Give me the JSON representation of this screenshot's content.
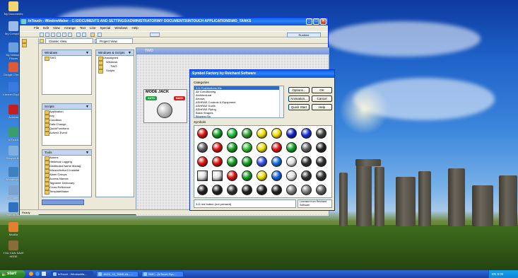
{
  "desktop": {
    "icons": [
      {
        "label": "My Documents",
        "color": "#f2d670"
      },
      {
        "label": "My Computer",
        "color": "#9bbce8"
      },
      {
        "label": "My Network Places",
        "color": "#6aa0e0"
      },
      {
        "label": "Google Chrome",
        "color": "#e05a3a"
      },
      {
        "label": "Internet Explorer",
        "color": "#3a7ae0"
      },
      {
        "label": "Acrobat",
        "color": "#c02020"
      },
      {
        "label": "InTouch",
        "color": "#3c9c6c"
      },
      {
        "label": "Recycle Bin",
        "color": "#7fb0e0"
      },
      {
        "label": "Wonderware",
        "color": "#4080c0"
      },
      {
        "label": "Computer",
        "color": "#7ca0d0"
      },
      {
        "label": "FactoryTalk",
        "color": "#3070c0"
      },
      {
        "label": "Mozilla",
        "color": "#e08030"
      },
      {
        "label": "YOU CAN SAVE HERE",
        "color": "#8a6b3a"
      }
    ]
  },
  "windowmaker": {
    "title": "InTouch - WindowMaker - C:\\DOCUMENTS AND SETTINGS\\ADMINISTRATOR\\MY DOCUMENTS\\INTOUCH APPLICATIONS\\MO_TANKS",
    "menu": [
      "File",
      "Edit",
      "View",
      "Arrange",
      "Text",
      "Line",
      "Special",
      "Windows",
      "Help"
    ],
    "runtime_label": "Runtime",
    "side_items": [
      "File",
      "Edit"
    ],
    "windows_panel": {
      "title": "Windows",
      "items": [
        "TWO"
      ]
    },
    "script_panel": {
      "title": "Scripts",
      "items": [
        "Application",
        "Key",
        "Condition",
        "Data Change",
        "QuickFunctions",
        "ActiveX Event"
      ]
    },
    "tools_panel": {
      "title": "Tools",
      "items": [
        "Alarms",
        "Historical Logging",
        "Distributed Name Manag",
        "Wizard/ActiveX Installat",
        "Alarm Groups",
        "Access Names",
        "Tagname Dictionary",
        "Cross Reference",
        "TemplateMaker"
      ]
    },
    "windows_scripts_panel": {
      "title": "Windows & Scripts",
      "items": [
        "Unassigned",
        "Windows",
        "TWO",
        "Scripts"
      ]
    },
    "project_view_label": "Project View",
    "classic_view_label": "Classic View",
    "canvas_title": "TWO",
    "status_text": "Ready",
    "mode_jack": {
      "title": "MODE JACK",
      "auto_label": "AUTO",
      "manual_label": "MANU"
    }
  },
  "symbol_factory": {
    "title": "Symbol Factory by Reichard Software",
    "categories_label": "Categories",
    "categories": [
      "3-D Pushbuttons Etc",
      "Air Conditioning",
      "Architectural",
      "Arrows",
      "ASHRAE Controls & Equipment",
      "ASHRAE Ducts",
      "ASHRAE Piping",
      "Basic Shapes",
      "Blowers Etc"
    ],
    "selected_index": 0,
    "buttons": {
      "options": "Options...",
      "ok": "OK",
      "animation": "Animation...",
      "cancel": "Cancel",
      "quick_start": "Quick Start",
      "help": "Help"
    },
    "symbols_label": "Symbols",
    "status": "3-D red button (not pressed)",
    "license": "Licensed from Reichard Software",
    "symbol_rows": [
      [
        "#e01010",
        "#10a020",
        "#20c040",
        "#30a030",
        "#f0e000",
        "#f0e000",
        "#1020c0",
        "#1830d8",
        "#404040"
      ],
      [
        "#606060",
        "#e01010",
        "#10a020",
        "#30c030",
        "#f0e000",
        "#e01010",
        "#10a020",
        "#606060",
        "#202020"
      ],
      [
        "#e01010",
        "#e01010",
        "#10a020",
        "#10a020",
        "#3050e0",
        "#1070e0",
        "#e0e0e0",
        "#303030",
        "#303030"
      ],
      [
        "#e0e0e0",
        "#e0e0e0",
        "#e01010",
        "#10a020",
        "#f0e000",
        "#1060e0",
        "#e0e0e0",
        "#303030",
        "#303030"
      ],
      [
        "#202020",
        "#202020",
        "#303030",
        "#202020",
        "#202020",
        "#202020",
        "#808080",
        "#808080",
        "#606060"
      ]
    ]
  },
  "taskbar": {
    "start_label": "start",
    "tasks": [
      "InTouch - WindowMa...",
      "JACK_12_TANK.xls - ...",
      "SMC - (InTouch Sys..."
    ],
    "tray_text": "EN 9:00"
  }
}
